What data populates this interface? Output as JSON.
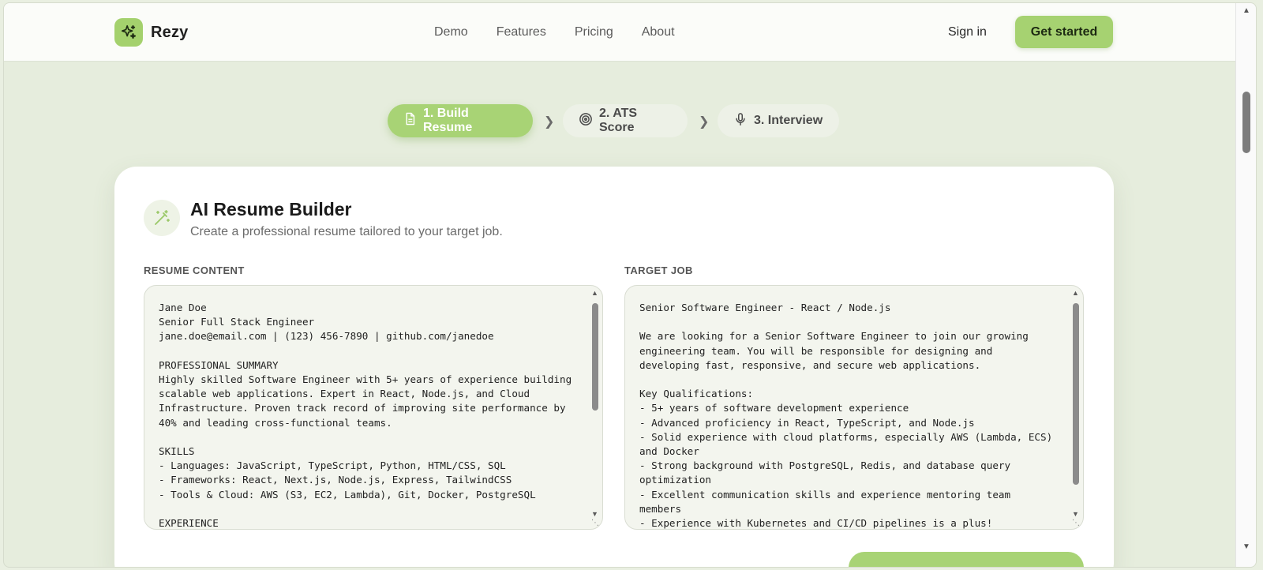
{
  "nav": {
    "brand": "Rezy",
    "links": [
      "Demo",
      "Features",
      "Pricing",
      "About"
    ],
    "sign_in": "Sign in",
    "cta": "Get started"
  },
  "steps": [
    {
      "label": "1. Build Resume",
      "icon": "document-icon",
      "active": true
    },
    {
      "label": "2. ATS Score",
      "icon": "target-icon",
      "active": false
    },
    {
      "label": "3. Interview",
      "icon": "microphone-icon",
      "active": false
    }
  ],
  "card": {
    "title": "AI Resume Builder",
    "subtitle": "Create a professional resume tailored to your target job.",
    "icon": "magic-wand-icon"
  },
  "resume": {
    "label": "RESUME CONTENT",
    "content": "Jane Doe\nSenior Full Stack Engineer\njane.doe@email.com | (123) 456-7890 | github.com/janedoe\n\nPROFESSIONAL SUMMARY\nHighly skilled Software Engineer with 5+ years of experience building\nscalable web applications. Expert in React, Node.js, and Cloud\nInfrastructure. Proven track record of improving site performance by\n40% and leading cross-functional teams.\n\nSKILLS\n- Languages: JavaScript, TypeScript, Python, HTML/CSS, SQL\n- Frameworks: React, Next.js, Node.js, Express, TailwindCSS\n- Tools & Cloud: AWS (S3, EC2, Lambda), Git, Docker, PostgreSQL\n\nEXPERIENCE"
  },
  "target_job": {
    "label": "TARGET JOB",
    "content": "Senior Software Engineer - React / Node.js\n\nWe are looking for a Senior Software Engineer to join our growing\nengineering team. You will be responsible for designing and\ndeveloping fast, responsive, and secure web applications.\n\nKey Qualifications:\n- 5+ years of software development experience\n- Advanced proficiency in React, TypeScript, and Node.js\n- Solid experience with cloud platforms, especially AWS (Lambda, ECS)\nand Docker\n- Strong background with PostgreSQL, Redis, and database query\noptimization\n- Excellent communication skills and experience mentoring team\nmembers\n- Experience with Kubernetes and CI/CD pipelines is a plus!"
  },
  "colors": {
    "accent": "#a8d375",
    "page_bg": "#e6eddd",
    "card_bg": "#ffffff"
  }
}
